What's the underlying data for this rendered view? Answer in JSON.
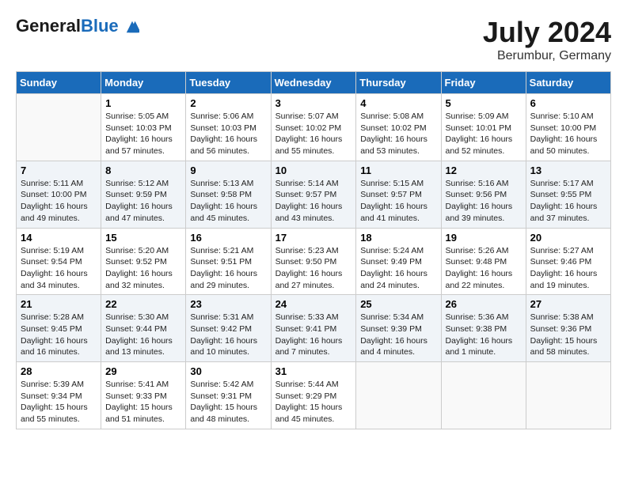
{
  "header": {
    "logo_general": "General",
    "logo_blue": "Blue",
    "month": "July 2024",
    "location": "Berumbur, Germany"
  },
  "weekdays": [
    "Sunday",
    "Monday",
    "Tuesday",
    "Wednesday",
    "Thursday",
    "Friday",
    "Saturday"
  ],
  "weeks": [
    [
      {
        "day": "",
        "info": ""
      },
      {
        "day": "1",
        "info": "Sunrise: 5:05 AM\nSunset: 10:03 PM\nDaylight: 16 hours\nand 57 minutes."
      },
      {
        "day": "2",
        "info": "Sunrise: 5:06 AM\nSunset: 10:03 PM\nDaylight: 16 hours\nand 56 minutes."
      },
      {
        "day": "3",
        "info": "Sunrise: 5:07 AM\nSunset: 10:02 PM\nDaylight: 16 hours\nand 55 minutes."
      },
      {
        "day": "4",
        "info": "Sunrise: 5:08 AM\nSunset: 10:02 PM\nDaylight: 16 hours\nand 53 minutes."
      },
      {
        "day": "5",
        "info": "Sunrise: 5:09 AM\nSunset: 10:01 PM\nDaylight: 16 hours\nand 52 minutes."
      },
      {
        "day": "6",
        "info": "Sunrise: 5:10 AM\nSunset: 10:00 PM\nDaylight: 16 hours\nand 50 minutes."
      }
    ],
    [
      {
        "day": "7",
        "info": "Sunrise: 5:11 AM\nSunset: 10:00 PM\nDaylight: 16 hours\nand 49 minutes."
      },
      {
        "day": "8",
        "info": "Sunrise: 5:12 AM\nSunset: 9:59 PM\nDaylight: 16 hours\nand 47 minutes."
      },
      {
        "day": "9",
        "info": "Sunrise: 5:13 AM\nSunset: 9:58 PM\nDaylight: 16 hours\nand 45 minutes."
      },
      {
        "day": "10",
        "info": "Sunrise: 5:14 AM\nSunset: 9:57 PM\nDaylight: 16 hours\nand 43 minutes."
      },
      {
        "day": "11",
        "info": "Sunrise: 5:15 AM\nSunset: 9:57 PM\nDaylight: 16 hours\nand 41 minutes."
      },
      {
        "day": "12",
        "info": "Sunrise: 5:16 AM\nSunset: 9:56 PM\nDaylight: 16 hours\nand 39 minutes."
      },
      {
        "day": "13",
        "info": "Sunrise: 5:17 AM\nSunset: 9:55 PM\nDaylight: 16 hours\nand 37 minutes."
      }
    ],
    [
      {
        "day": "14",
        "info": "Sunrise: 5:19 AM\nSunset: 9:54 PM\nDaylight: 16 hours\nand 34 minutes."
      },
      {
        "day": "15",
        "info": "Sunrise: 5:20 AM\nSunset: 9:52 PM\nDaylight: 16 hours\nand 32 minutes."
      },
      {
        "day": "16",
        "info": "Sunrise: 5:21 AM\nSunset: 9:51 PM\nDaylight: 16 hours\nand 29 minutes."
      },
      {
        "day": "17",
        "info": "Sunrise: 5:23 AM\nSunset: 9:50 PM\nDaylight: 16 hours\nand 27 minutes."
      },
      {
        "day": "18",
        "info": "Sunrise: 5:24 AM\nSunset: 9:49 PM\nDaylight: 16 hours\nand 24 minutes."
      },
      {
        "day": "19",
        "info": "Sunrise: 5:26 AM\nSunset: 9:48 PM\nDaylight: 16 hours\nand 22 minutes."
      },
      {
        "day": "20",
        "info": "Sunrise: 5:27 AM\nSunset: 9:46 PM\nDaylight: 16 hours\nand 19 minutes."
      }
    ],
    [
      {
        "day": "21",
        "info": "Sunrise: 5:28 AM\nSunset: 9:45 PM\nDaylight: 16 hours\nand 16 minutes."
      },
      {
        "day": "22",
        "info": "Sunrise: 5:30 AM\nSunset: 9:44 PM\nDaylight: 16 hours\nand 13 minutes."
      },
      {
        "day": "23",
        "info": "Sunrise: 5:31 AM\nSunset: 9:42 PM\nDaylight: 16 hours\nand 10 minutes."
      },
      {
        "day": "24",
        "info": "Sunrise: 5:33 AM\nSunset: 9:41 PM\nDaylight: 16 hours\nand 7 minutes."
      },
      {
        "day": "25",
        "info": "Sunrise: 5:34 AM\nSunset: 9:39 PM\nDaylight: 16 hours\nand 4 minutes."
      },
      {
        "day": "26",
        "info": "Sunrise: 5:36 AM\nSunset: 9:38 PM\nDaylight: 16 hours\nand 1 minute."
      },
      {
        "day": "27",
        "info": "Sunrise: 5:38 AM\nSunset: 9:36 PM\nDaylight: 15 hours\nand 58 minutes."
      }
    ],
    [
      {
        "day": "28",
        "info": "Sunrise: 5:39 AM\nSunset: 9:34 PM\nDaylight: 15 hours\nand 55 minutes."
      },
      {
        "day": "29",
        "info": "Sunrise: 5:41 AM\nSunset: 9:33 PM\nDaylight: 15 hours\nand 51 minutes."
      },
      {
        "day": "30",
        "info": "Sunrise: 5:42 AM\nSunset: 9:31 PM\nDaylight: 15 hours\nand 48 minutes."
      },
      {
        "day": "31",
        "info": "Sunrise: 5:44 AM\nSunset: 9:29 PM\nDaylight: 15 hours\nand 45 minutes."
      },
      {
        "day": "",
        "info": ""
      },
      {
        "day": "",
        "info": ""
      },
      {
        "day": "",
        "info": ""
      }
    ]
  ]
}
